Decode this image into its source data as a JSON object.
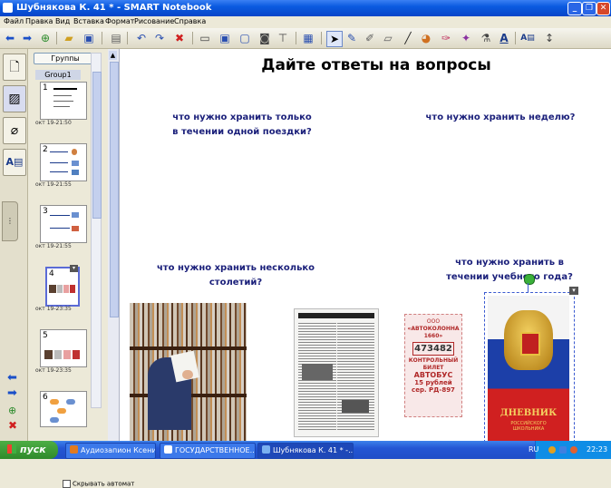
{
  "window": {
    "title": "Шубнякова К. 41 * - SMART Notebook",
    "minimize": "_",
    "maximize": "❐",
    "close": "✕"
  },
  "menu": [
    "Файл",
    "Правка",
    "Вид",
    "Вставка",
    "Формат",
    "Рисование",
    "Справка"
  ],
  "sorter": {
    "groups_button": "Группы",
    "group_label": "Group1",
    "pages": [
      {
        "num": "1",
        "time": "окт 19-21:50"
      },
      {
        "num": "2",
        "time": "окт 19-21:55"
      },
      {
        "num": "3",
        "time": "окт 19-21:55"
      },
      {
        "num": "4",
        "time": "окт 19-23:35"
      },
      {
        "num": "5",
        "time": "окт 19-23:35"
      },
      {
        "num": "6",
        "time": ""
      }
    ],
    "hide_auto": "Скрывать автомат"
  },
  "page": {
    "title": "Дайте ответы на вопросы",
    "q1": "что нужно хранить только\nв течении одной поездки?",
    "q2": "что нужно хранить неделю?",
    "q3": "что нужно хранить несколько\nстолетий?",
    "q4": "что нужно хранить в\nтечении учебного года?",
    "ticket": {
      "line1": "ООО",
      "line2": "«АВТОКОЛОННА 1660»",
      "number": "473482",
      "line3": "КОНТРОЛЬНЫЙ",
      "line4": "БИЛЕТ",
      "line5": "АВТОБУС",
      "price": "15 рублей",
      "series": "сер. РД-897"
    },
    "diary": {
      "title": "ДНЕВНИК",
      "subtitle": "РОССИЙСКОГО\nШКОЛЬНИКА"
    }
  },
  "taskbar": {
    "start": "пуск",
    "tasks": [
      {
        "label": "Аудиозапион Ксени...",
        "color": "#e07a20"
      },
      {
        "label": "ГОСУДАРСТВЕННОЕ...",
        "color": "#2a5fc0"
      },
      {
        "label": "Шубнякова К. 41 * -...",
        "color": "#3a8ad8"
      }
    ],
    "lang": "RU",
    "clock": "22:23"
  }
}
